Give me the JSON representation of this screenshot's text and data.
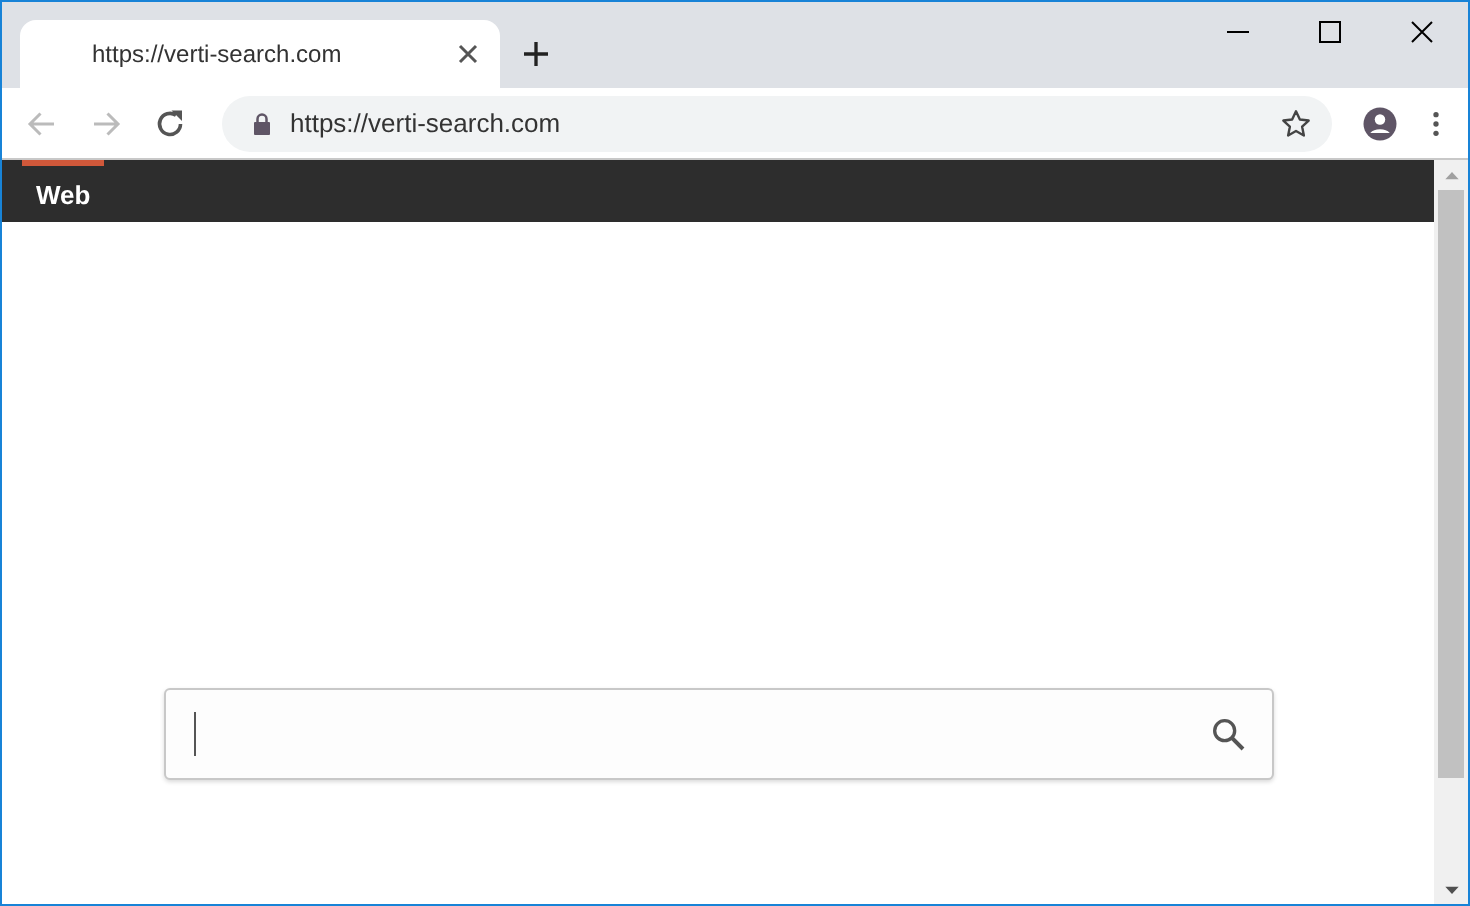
{
  "browser": {
    "tab_title": "https://verti-search.com",
    "address": "https://verti-search.com"
  },
  "nav_tabs": [
    {
      "label": "Web",
      "selected": true
    }
  ]
}
